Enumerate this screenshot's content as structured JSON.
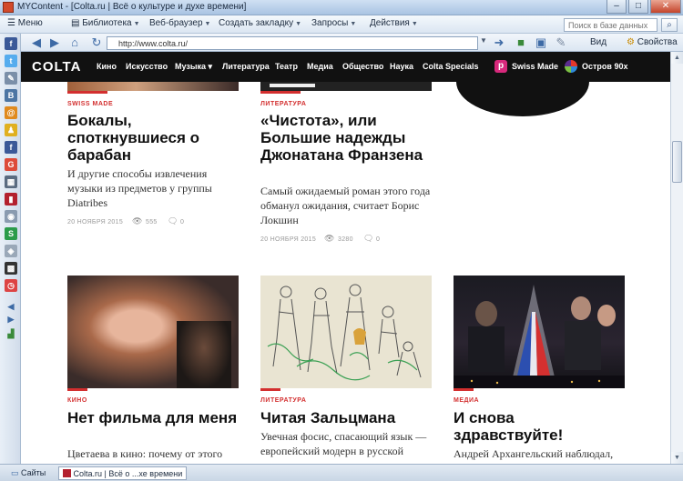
{
  "window": {
    "title": "MYContent - [Colta.ru | Всё о культуре и духе времени]",
    "controls": [
      "–",
      "□",
      "✕"
    ]
  },
  "menubar": {
    "items": [
      {
        "label": "Меню"
      },
      {
        "label": "Библиотека",
        "arrow": "▼"
      },
      {
        "label": "Веб-браузер",
        "arrow": "▼"
      },
      {
        "label": "Создать закладку",
        "arrow": "▼"
      },
      {
        "label": "Запросы",
        "arrow": "▼"
      },
      {
        "label": "Действия",
        "arrow": "▼"
      }
    ],
    "search_placeholder": "Поиск в базе данных"
  },
  "navbar": {
    "url": "http://www.colta.ru/",
    "view_label": "Вид",
    "properties_label": "Свойства"
  },
  "site": {
    "logo": "COLTA",
    "nav": [
      "Кино",
      "Искусство",
      "Музыка ▾",
      "Литература",
      "Театр",
      "Медиа",
      "Общество",
      "Наука",
      "Colta Specials"
    ],
    "special1": {
      "badge": "p",
      "label": "Swiss Made"
    },
    "special2": {
      "label": "Остров 90х"
    }
  },
  "articles_top": [
    {
      "kicker": "SWISS MADE",
      "headline": "Бокалы, споткнувшиеся о барабан",
      "lead": "И другие способы извлечения музыки из предметов у группы Diatribes",
      "date": "20 НОЯБРЯ 2015",
      "views": "555",
      "comments": "0"
    },
    {
      "kicker": "ЛИТЕРАТУРА",
      "headline": "«Чистота», или Большие надежды Джонатана Франзена",
      "lead": "Самый ожидаемый роман этого года обманул ожидания, считает Борис Локшин",
      "date": "20 НОЯБРЯ 2015",
      "views": "3280",
      "comments": "0"
    }
  ],
  "articles_bottom": [
    {
      "kicker": "КИНО",
      "headline": "Нет фильма для меня",
      "lead": "Цветаева в кино: почему от этого"
    },
    {
      "kicker": "ЛИТЕРАТУРА",
      "headline": "Читая Зальцмана",
      "lead": "Увечная фосис, спасающий язык — европейский модерн в русской"
    },
    {
      "kicker": "МЕДИА",
      "headline": "И снова здравствуйте!",
      "lead": "Андрей Архангельский наблюдал,"
    }
  ],
  "statusbar": {
    "tabs": [
      {
        "label": "Сайты"
      },
      {
        "label": "Colta.ru | Всё о ...хе времени",
        "active": true
      }
    ]
  },
  "colors": {
    "accent": "#d32f2f",
    "nav_bg": "#111111",
    "swiss_badge": "#d8297c"
  }
}
